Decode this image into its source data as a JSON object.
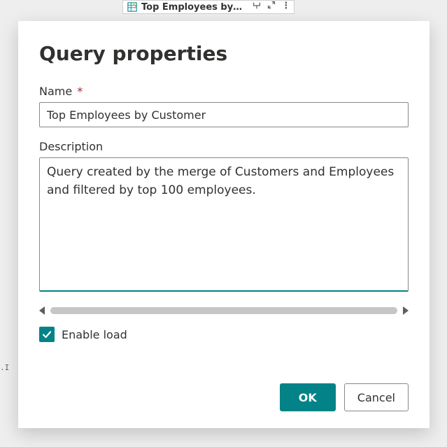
{
  "background": {
    "tab_title": "Top Employees by…",
    "left_snippet": ".I"
  },
  "modal": {
    "title": "Query properties",
    "name_label": "Name",
    "name_required_marker": "*",
    "name_value": "Top Employees by Customer",
    "description_label": "Description",
    "description_value": "Query created by the merge of Customers and Employees and filtered by top 100 employees.",
    "enable_load_label": "Enable load",
    "enable_load_checked": true,
    "ok_label": "OK",
    "cancel_label": "Cancel"
  },
  "colors": {
    "accent": "#038387",
    "required": "#a4262c"
  }
}
